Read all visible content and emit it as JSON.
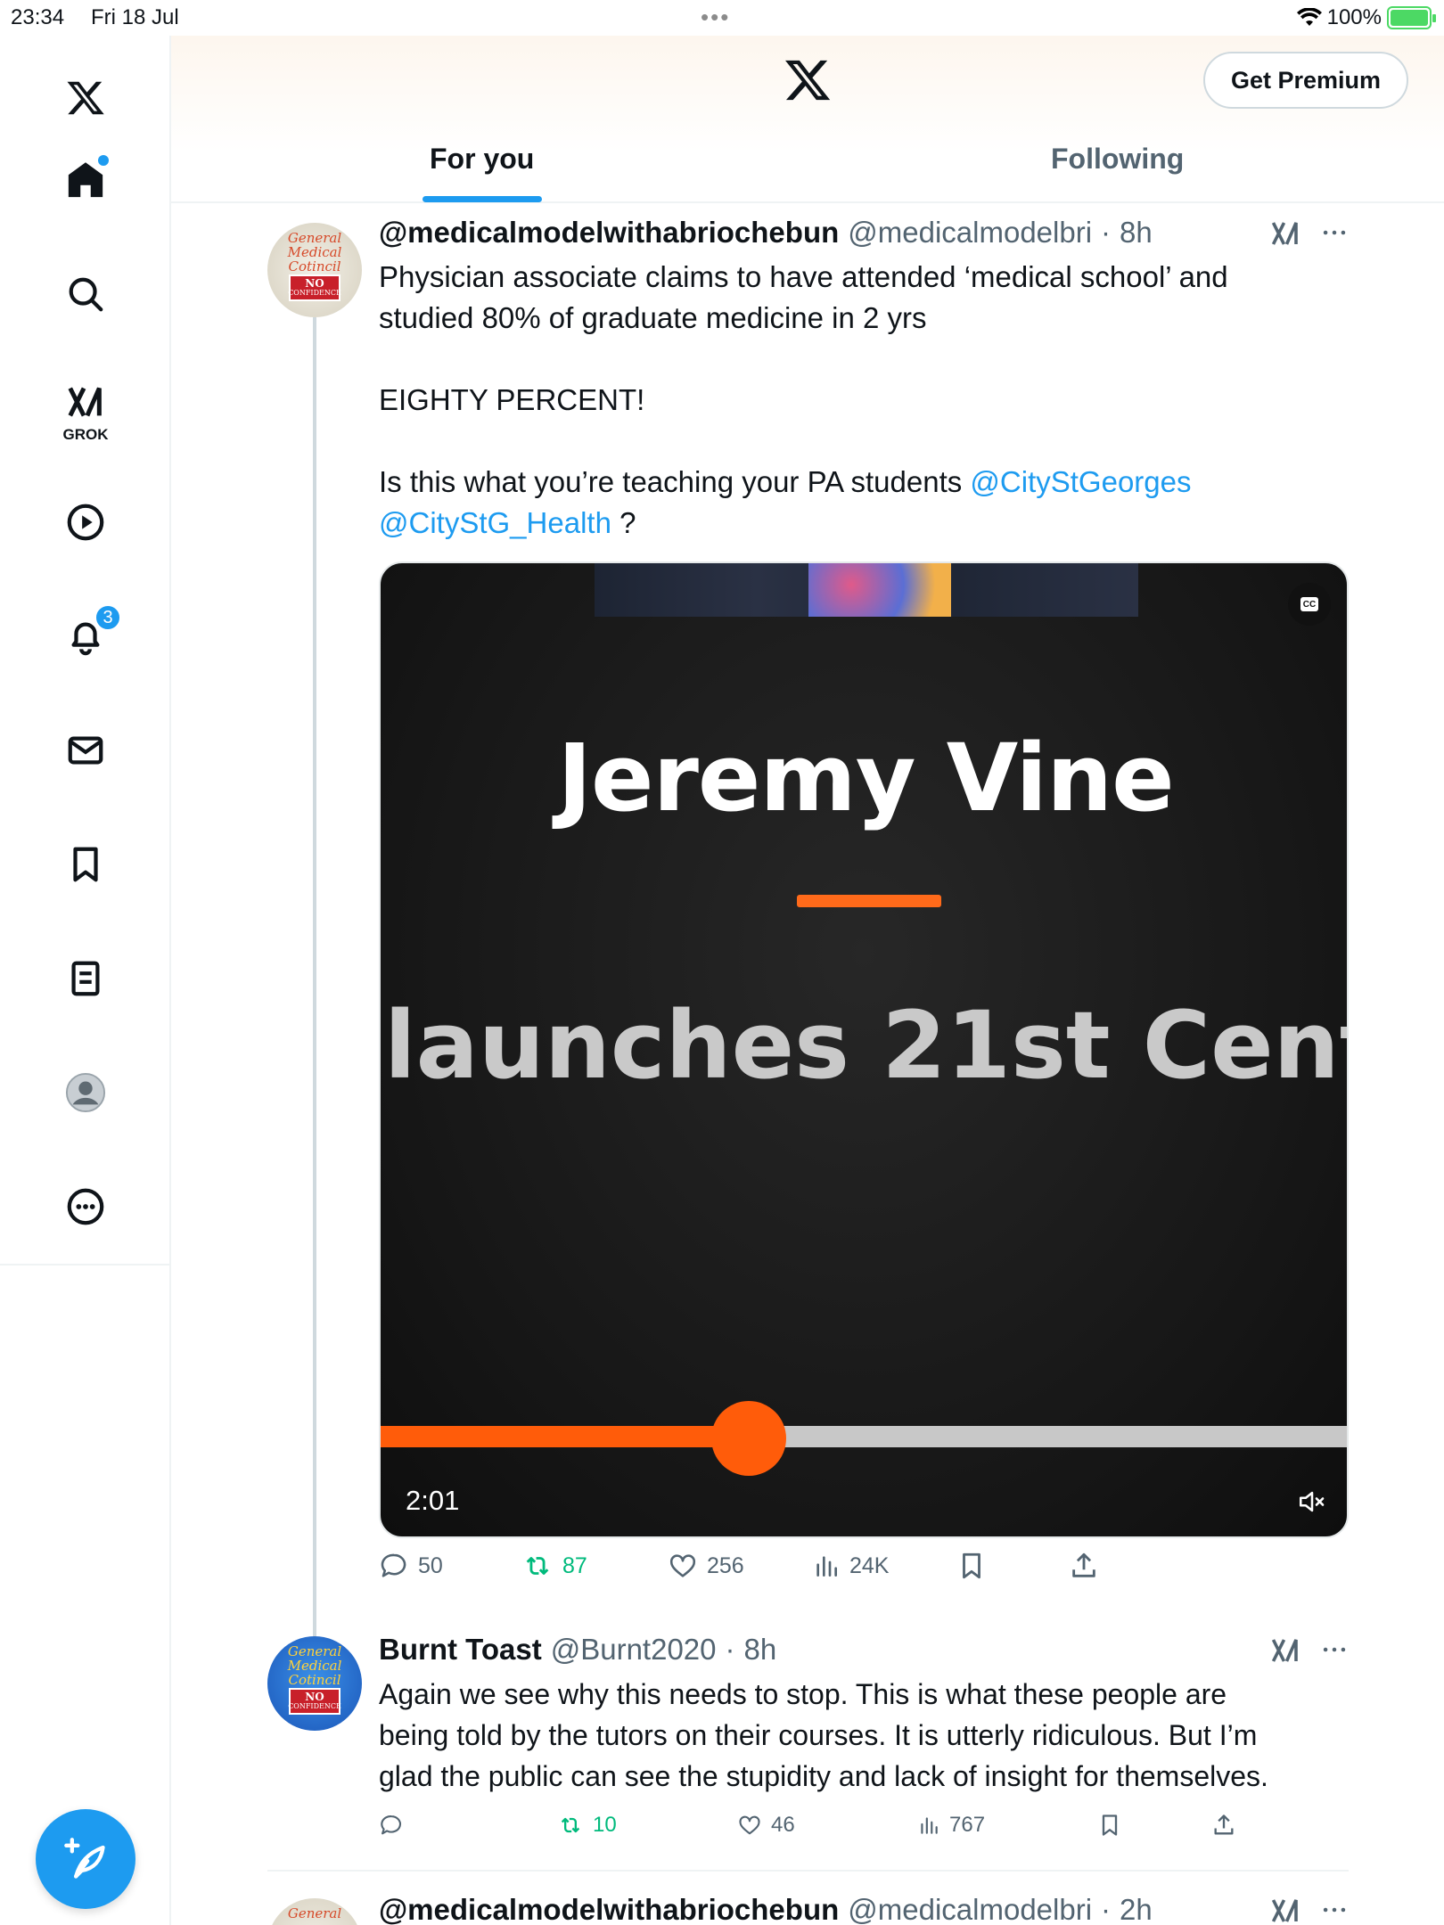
{
  "status": {
    "time": "23:34",
    "date": "Fri 18 Jul",
    "battery": "100%"
  },
  "sidebar": {
    "grok_label": "GROK",
    "notifications_count": "3"
  },
  "header": {
    "premium_label": "Get Premium",
    "tabs": [
      {
        "label": "For you",
        "active": true
      },
      {
        "label": "Following",
        "active": false
      }
    ]
  },
  "colors": {
    "accent": "#1d9bf0",
    "repost": "#00ba7c",
    "video_accent": "#ff5c0a",
    "text": "#0f1419",
    "muted": "#536471"
  },
  "tweets": [
    {
      "name": "@medicalmodelwithabriochebun",
      "handle": "@medicalmodelbri",
      "time": "8h",
      "avatar_text": [
        "General",
        "Medical",
        "Cotincil",
        "NO",
        "CONFIDENCE"
      ],
      "line1": "Physician associate claims to have attended ‘medical school’ and",
      "line2": "studied 80% of graduate medicine in 2 yrs",
      "line3": "EIGHTY PERCENT!",
      "line4": "Is this what you’re teaching your PA students",
      "mention1": "@CityStGeorges",
      "mention2": "@CityStG_Health",
      "line4_end": " ?",
      "video": {
        "title": "Jeremy Vine",
        "subtitle": "launches 21st Centu",
        "time": "2:01",
        "progress": 0.38
      },
      "stats": {
        "replies": "50",
        "reposts": "87",
        "likes": "256",
        "views": "24K"
      }
    },
    {
      "name": "Burnt Toast",
      "handle": "@Burnt2020",
      "time": "8h",
      "avatar_text": [
        "General",
        "Medical",
        "Cotincil",
        "NO",
        "CONFIDENCE"
      ],
      "line1": "Again we see why this needs to stop. This is what these people are",
      "line2": "being told by the tutors on their courses. It is utterly ridiculous. But I’m",
      "line3": "glad the public can see the stupidity and lack of insight for themselves.",
      "stats": {
        "replies": "",
        "reposts": "10",
        "likes": "46",
        "views": "767"
      }
    },
    {
      "name": "@medicalmodelwithabriochebun",
      "handle": "@medicalmodelbri",
      "time": "2h",
      "avatar_text": [
        "General"
      ]
    }
  ]
}
